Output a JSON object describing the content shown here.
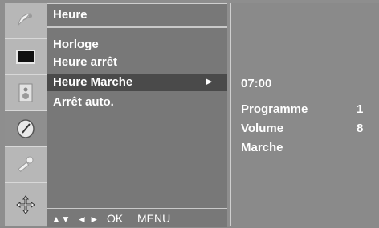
{
  "menu": {
    "title": "Heure",
    "items": [
      {
        "label": "Horloge",
        "selected": false
      },
      {
        "label": "Heure arrêt",
        "selected": false
      },
      {
        "label": "Heure Marche",
        "selected": true,
        "arrow": "►"
      },
      {
        "label": "Arrêt auto.",
        "selected": false
      }
    ],
    "nav_hints": {
      "up_down": "▲▼",
      "left_right": "◄ ►",
      "ok": "OK",
      "menu": "MENU"
    }
  },
  "sub_panel": {
    "time": "07:00",
    "rows": [
      {
        "label": "Programme",
        "value": "1"
      },
      {
        "label": "Volume",
        "value": "8"
      },
      {
        "label": "Marche",
        "value": ""
      }
    ]
  },
  "icons": [
    "satellite-dish-icon",
    "screen-icon",
    "speaker-icon",
    "clock-icon",
    "key-icon",
    "arrows-icon"
  ],
  "colors": {
    "menu_bg": "#787878",
    "selected_bg": "#4a4a4a",
    "strip_bg": "#b7b7b7",
    "text": "#ffffff"
  }
}
